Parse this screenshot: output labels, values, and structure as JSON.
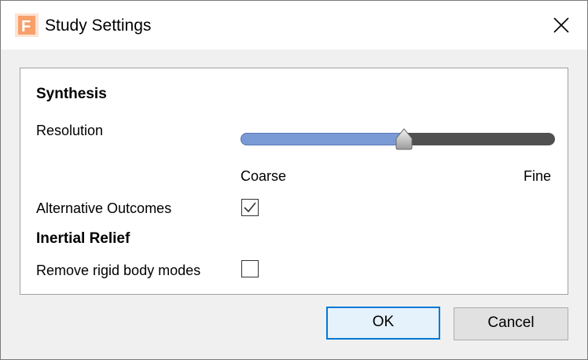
{
  "window": {
    "title": "Study Settings",
    "app_icon": "fusion-app-icon",
    "close_icon": "close-icon"
  },
  "synthesis": {
    "heading": "Synthesis",
    "resolution_label": "Resolution",
    "resolution_value": 0.52,
    "coarse_label": "Coarse",
    "fine_label": "Fine",
    "alt_outcomes_label": "Alternative Outcomes",
    "alt_outcomes_checked": true
  },
  "inertial_relief": {
    "heading": "Inertial Relief",
    "remove_rigid_label": "Remove rigid body modes",
    "remove_rigid_checked": false
  },
  "buttons": {
    "ok_label": "OK",
    "cancel_label": "Cancel"
  },
  "colors": {
    "slider_fill": "#7a9ad6",
    "slider_track": "#505050",
    "default_button_border": "#0078d7",
    "app_icon_orange": "#f26d21"
  }
}
